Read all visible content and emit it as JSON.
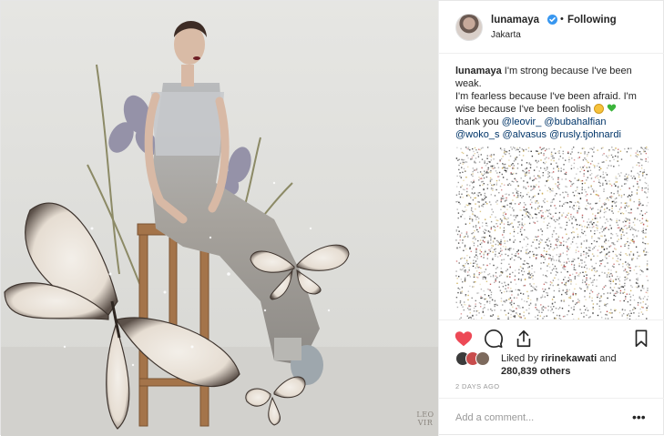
{
  "post": {
    "watermark": "LEO\nVIR",
    "author": {
      "username": "lunamaya",
      "verified": true,
      "separator": "•",
      "follow_status": "Following",
      "location": "Jakarta"
    },
    "caption": {
      "username": "lunamaya",
      "text_1": " I'm strong because I've been weak.",
      "text_2": "I'm fearless because I've been afraid. I'm wise because I've been foolish ",
      "thanks": "thank you ",
      "mentions": [
        "@leovir_",
        "@bubahalfian",
        "@woko_s",
        "@alvasus",
        "@rusly.tjohnardi"
      ]
    },
    "likes": {
      "prefix": "Liked by ",
      "first_liker": "ririnekawati",
      "middle": " and",
      "others": "280,839 others"
    },
    "timestamp": "2 DAYS AGO",
    "comment": {
      "placeholder": "Add a comment...",
      "more": "•••"
    },
    "icons": {
      "like": "heart-icon",
      "comment": "comment-icon",
      "share": "share-icon",
      "save": "bookmark-icon"
    },
    "colors": {
      "liked_heart": "#ed4956",
      "verified_badge": "#3897f0",
      "mention": "#003569"
    }
  }
}
